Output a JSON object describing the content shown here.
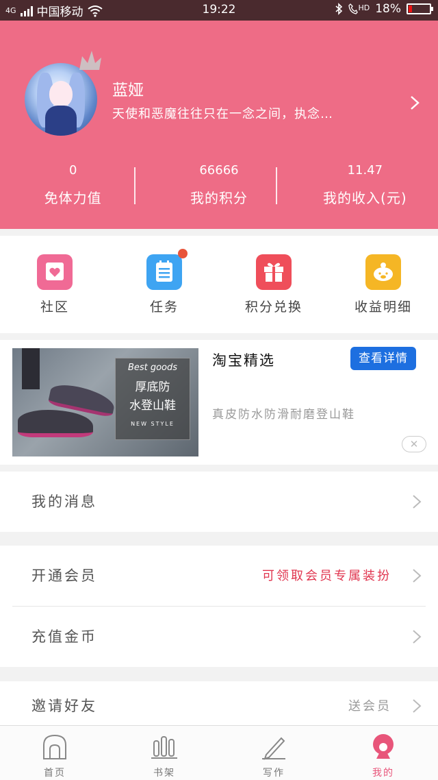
{
  "status_bar": {
    "carrier": "中国移动",
    "network": "4G",
    "time": "19:22",
    "hd": "HD",
    "battery": "18%",
    "battery_level": 0.18
  },
  "profile": {
    "name": "蓝娅",
    "signature": "天使和恶魔往往只在一念之间，执念…",
    "stats": [
      {
        "value": "0",
        "label": "免体力值"
      },
      {
        "value": "66666",
        "label": "我的积分"
      },
      {
        "value": "11.47",
        "label": "我的收入(元)"
      }
    ]
  },
  "quick_actions": [
    {
      "label": "社区",
      "icon": "community-heart-icon",
      "color": "#f06a95"
    },
    {
      "label": "任务",
      "icon": "task-list-icon",
      "color": "#3ea4f2",
      "has_badge": true
    },
    {
      "label": "积分兑换",
      "icon": "gift-box-icon",
      "color": "#ef4e5a"
    },
    {
      "label": "收益明细",
      "icon": "piggy-bank-icon",
      "color": "#f5b625"
    }
  ],
  "ad": {
    "image_caption_en": "Best goods",
    "image_line1": "厚底防",
    "image_line2": "水登山鞋",
    "image_caption_footer": "NEW STYLE",
    "title": "淘宝精选",
    "button": "查看详情",
    "description": "真皮防水防滑耐磨登山鞋",
    "close": "✕"
  },
  "menu": {
    "messages": {
      "label": "我的消息"
    },
    "vip": {
      "label": "开通会员",
      "extra": "可领取会员专属装扮",
      "extra_color": "#e0344e"
    },
    "recharge": {
      "label": "充值金币"
    },
    "invite": {
      "label": "邀请好友",
      "extra": "送会员",
      "extra_color": "#999999"
    }
  },
  "tabbar": [
    {
      "label": "首页",
      "icon": "home-icon"
    },
    {
      "label": "书架",
      "icon": "bookshelf-icon"
    },
    {
      "label": "写作",
      "icon": "pen-icon"
    },
    {
      "label": "我的",
      "icon": "profile-icon",
      "active": true
    }
  ],
  "colors": {
    "header_bg": "#ee6c86",
    "accent": "#e8557a",
    "ad_button": "#1d6fe0"
  }
}
